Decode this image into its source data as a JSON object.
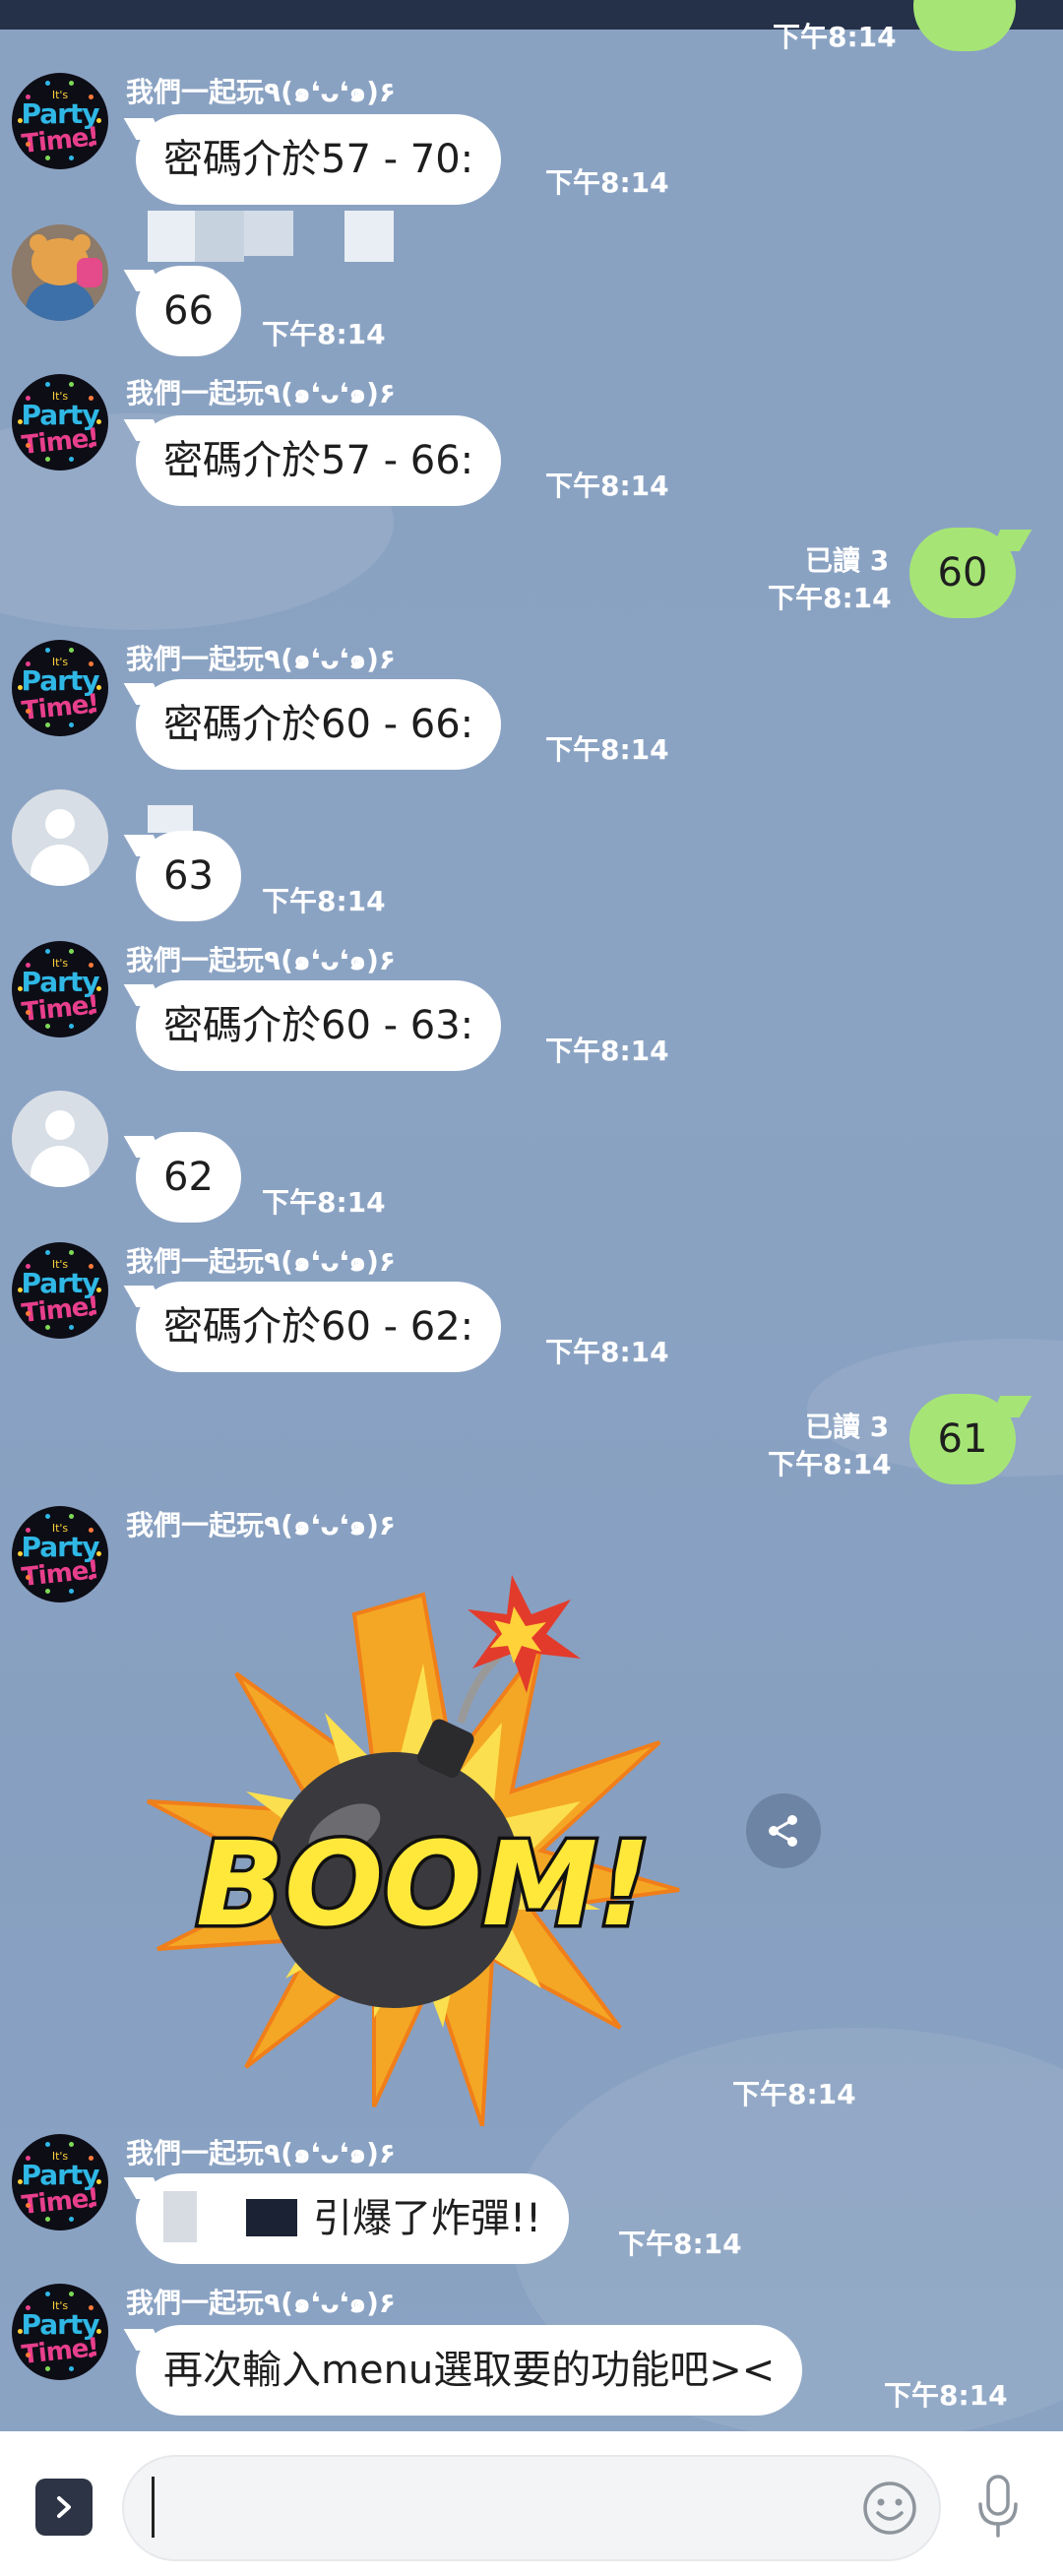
{
  "chat": {
    "top_time_partial": "下午8:14",
    "messages": [
      {
        "sender": "我們一起玩٩(๑❛ᴗ❛๑)۶",
        "text": "密碼介於57 - 70:",
        "time": "下午8:14"
      },
      {
        "text": "66",
        "time": "下午8:14"
      },
      {
        "sender": "我們一起玩٩(๑❛ᴗ❛๑)۶",
        "text": "密碼介於57 - 66:",
        "time": "下午8:14"
      },
      {
        "read": "已讀 3",
        "time": "下午8:14",
        "text": "60"
      },
      {
        "sender": "我們一起玩٩(๑❛ᴗ❛๑)۶",
        "text": "密碼介於60 - 66:",
        "time": "下午8:14"
      },
      {
        "text": "63",
        "time": "下午8:14"
      },
      {
        "sender": "我們一起玩٩(๑❛ᴗ❛๑)۶",
        "text": "密碼介於60 - 63:",
        "time": "下午8:14"
      },
      {
        "text": "62",
        "time": "下午8:14"
      },
      {
        "sender": "我們一起玩٩(๑❛ᴗ❛๑)۶",
        "text": "密碼介於60 - 62:",
        "time": "下午8:14"
      },
      {
        "read": "已讀 3",
        "time": "下午8:14",
        "text": "61"
      },
      {
        "sender": "我們一起玩٩(๑❛ᴗ❛๑)۶",
        "sticker_text": "BOOM!",
        "time": "下午8:14"
      },
      {
        "sender": "我們一起玩٩(๑❛ᴗ❛๑)۶",
        "text": "引爆了炸彈!!",
        "time": "下午8:14"
      },
      {
        "sender": "我們一起玩٩(๑❛ᴗ❛๑)۶",
        "text": "再次輸入menu選取要的功能吧><",
        "time": "下午8:14"
      }
    ]
  },
  "bot_avatar": {
    "line1": "It's",
    "line2": "Party",
    "line3": "Time!"
  },
  "icons": {
    "expand": "chevron-right-icon",
    "emoji": "smiley-icon",
    "mic": "microphone-icon",
    "share": "share-icon"
  },
  "colors": {
    "background": "#8aa2c2",
    "incoming_bubble": "#ffffff",
    "outgoing_bubble": "#a6e575",
    "status_bar": "#253049"
  },
  "input": {
    "value": "",
    "placeholder": ""
  }
}
